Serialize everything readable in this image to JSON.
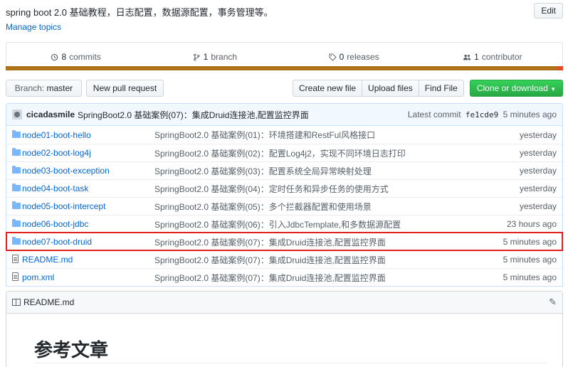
{
  "repo": {
    "description": "spring boot 2.0 基础教程，日志配置，数据源配置，事务管理等。",
    "edit_label": "Edit",
    "manage_topics": "Manage topics"
  },
  "summary": {
    "commits_count": "8",
    "commits_label": "commits",
    "branch_count": "1",
    "branch_label": "branch",
    "releases_count": "0",
    "releases_label": "releases",
    "contributor_count": "1",
    "contributor_label": "contributor"
  },
  "language_colors": {
    "primary": "#b07219",
    "secondary": "#e34c26"
  },
  "toolbar": {
    "branch_label": "Branch:",
    "branch_value": "master",
    "new_pr": "New pull request",
    "create_file": "Create new file",
    "upload_files": "Upload files",
    "find_file": "Find File",
    "clone": "Clone or download"
  },
  "latest_commit": {
    "author": "cicadasmile",
    "message": "SpringBoot2.0 基础案例(07)：集成Druid连接池,配置监控界面",
    "prefix": "Latest commit",
    "sha": "fe1cde9",
    "age": "5 minutes ago"
  },
  "files": [
    {
      "type": "dir",
      "name": "node01-boot-hello",
      "message": "SpringBoot2.0 基础案例(01)：环境搭建和RestFul风格接口",
      "age": "yesterday"
    },
    {
      "type": "dir",
      "name": "node02-boot-log4j",
      "message": "SpringBoot2.0 基础案例(02)：配置Log4j2，实现不同环境日志打印",
      "age": "yesterday"
    },
    {
      "type": "dir",
      "name": "node03-boot-exception",
      "message": "SpringBoot2.0 基础案例(03)：配置系统全局异常映射处理",
      "age": "yesterday"
    },
    {
      "type": "dir",
      "name": "node04-boot-task",
      "message": "SpringBoot2.0 基础案例(04)：定时任务和异步任务的使用方式",
      "age": "yesterday"
    },
    {
      "type": "dir",
      "name": "node05-boot-intercept",
      "message": "SpringBoot2.0 基础案例(05)：多个拦截器配置和使用场景",
      "age": "yesterday"
    },
    {
      "type": "dir",
      "name": "node06-boot-jdbc",
      "message": "SpringBoot2.0 基础案例(06)：引入JdbcTemplate,和多数据源配置",
      "age": "23 hours ago"
    },
    {
      "type": "dir",
      "name": "node07-boot-druid",
      "message": "SpringBoot2.0 基础案例(07)：集成Druid连接池,配置监控界面",
      "age": "5 minutes ago"
    },
    {
      "type": "file",
      "name": "README.md",
      "message": "SpringBoot2.0 基础案例(07)：集成Druid连接池,配置监控界面",
      "age": "5 minutes ago"
    },
    {
      "type": "file",
      "name": "pom.xml",
      "message": "SpringBoot2.0 基础案例(07)：集成Druid连接池,配置监控界面",
      "age": "5 minutes ago"
    }
  ],
  "readme": {
    "filename": "README.md",
    "heading": "参考文章"
  }
}
